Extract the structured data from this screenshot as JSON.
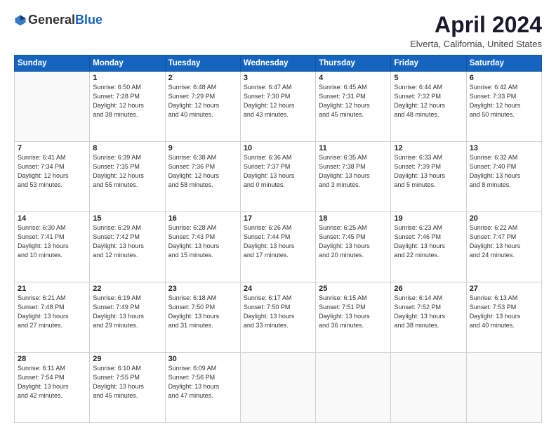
{
  "header": {
    "logo_general": "General",
    "logo_blue": "Blue",
    "title": "April 2024",
    "location": "Elverta, California, United States"
  },
  "weekdays": [
    "Sunday",
    "Monday",
    "Tuesday",
    "Wednesday",
    "Thursday",
    "Friday",
    "Saturday"
  ],
  "weeks": [
    [
      {
        "day": "",
        "text": ""
      },
      {
        "day": "1",
        "text": "Sunrise: 6:50 AM\nSunset: 7:28 PM\nDaylight: 12 hours\nand 38 minutes."
      },
      {
        "day": "2",
        "text": "Sunrise: 6:48 AM\nSunset: 7:29 PM\nDaylight: 12 hours\nand 40 minutes."
      },
      {
        "day": "3",
        "text": "Sunrise: 6:47 AM\nSunset: 7:30 PM\nDaylight: 12 hours\nand 43 minutes."
      },
      {
        "day": "4",
        "text": "Sunrise: 6:45 AM\nSunset: 7:31 PM\nDaylight: 12 hours\nand 45 minutes."
      },
      {
        "day": "5",
        "text": "Sunrise: 6:44 AM\nSunset: 7:32 PM\nDaylight: 12 hours\nand 48 minutes."
      },
      {
        "day": "6",
        "text": "Sunrise: 6:42 AM\nSunset: 7:33 PM\nDaylight: 12 hours\nand 50 minutes."
      }
    ],
    [
      {
        "day": "7",
        "text": "Sunrise: 6:41 AM\nSunset: 7:34 PM\nDaylight: 12 hours\nand 53 minutes."
      },
      {
        "day": "8",
        "text": "Sunrise: 6:39 AM\nSunset: 7:35 PM\nDaylight: 12 hours\nand 55 minutes."
      },
      {
        "day": "9",
        "text": "Sunrise: 6:38 AM\nSunset: 7:36 PM\nDaylight: 12 hours\nand 58 minutes."
      },
      {
        "day": "10",
        "text": "Sunrise: 6:36 AM\nSunset: 7:37 PM\nDaylight: 13 hours\nand 0 minutes."
      },
      {
        "day": "11",
        "text": "Sunrise: 6:35 AM\nSunset: 7:38 PM\nDaylight: 13 hours\nand 3 minutes."
      },
      {
        "day": "12",
        "text": "Sunrise: 6:33 AM\nSunset: 7:39 PM\nDaylight: 13 hours\nand 5 minutes."
      },
      {
        "day": "13",
        "text": "Sunrise: 6:32 AM\nSunset: 7:40 PM\nDaylight: 13 hours\nand 8 minutes."
      }
    ],
    [
      {
        "day": "14",
        "text": "Sunrise: 6:30 AM\nSunset: 7:41 PM\nDaylight: 13 hours\nand 10 minutes."
      },
      {
        "day": "15",
        "text": "Sunrise: 6:29 AM\nSunset: 7:42 PM\nDaylight: 13 hours\nand 12 minutes."
      },
      {
        "day": "16",
        "text": "Sunrise: 6:28 AM\nSunset: 7:43 PM\nDaylight: 13 hours\nand 15 minutes."
      },
      {
        "day": "17",
        "text": "Sunrise: 6:26 AM\nSunset: 7:44 PM\nDaylight: 13 hours\nand 17 minutes."
      },
      {
        "day": "18",
        "text": "Sunrise: 6:25 AM\nSunset: 7:45 PM\nDaylight: 13 hours\nand 20 minutes."
      },
      {
        "day": "19",
        "text": "Sunrise: 6:23 AM\nSunset: 7:46 PM\nDaylight: 13 hours\nand 22 minutes."
      },
      {
        "day": "20",
        "text": "Sunrise: 6:22 AM\nSunset: 7:47 PM\nDaylight: 13 hours\nand 24 minutes."
      }
    ],
    [
      {
        "day": "21",
        "text": "Sunrise: 6:21 AM\nSunset: 7:48 PM\nDaylight: 13 hours\nand 27 minutes."
      },
      {
        "day": "22",
        "text": "Sunrise: 6:19 AM\nSunset: 7:49 PM\nDaylight: 13 hours\nand 29 minutes."
      },
      {
        "day": "23",
        "text": "Sunrise: 6:18 AM\nSunset: 7:50 PM\nDaylight: 13 hours\nand 31 minutes."
      },
      {
        "day": "24",
        "text": "Sunrise: 6:17 AM\nSunset: 7:50 PM\nDaylight: 13 hours\nand 33 minutes."
      },
      {
        "day": "25",
        "text": "Sunrise: 6:15 AM\nSunset: 7:51 PM\nDaylight: 13 hours\nand 36 minutes."
      },
      {
        "day": "26",
        "text": "Sunrise: 6:14 AM\nSunset: 7:52 PM\nDaylight: 13 hours\nand 38 minutes."
      },
      {
        "day": "27",
        "text": "Sunrise: 6:13 AM\nSunset: 7:53 PM\nDaylight: 13 hours\nand 40 minutes."
      }
    ],
    [
      {
        "day": "28",
        "text": "Sunrise: 6:11 AM\nSunset: 7:54 PM\nDaylight: 13 hours\nand 42 minutes."
      },
      {
        "day": "29",
        "text": "Sunrise: 6:10 AM\nSunset: 7:55 PM\nDaylight: 13 hours\nand 45 minutes."
      },
      {
        "day": "30",
        "text": "Sunrise: 6:09 AM\nSunset: 7:56 PM\nDaylight: 13 hours\nand 47 minutes."
      },
      {
        "day": "",
        "text": ""
      },
      {
        "day": "",
        "text": ""
      },
      {
        "day": "",
        "text": ""
      },
      {
        "day": "",
        "text": ""
      }
    ]
  ]
}
